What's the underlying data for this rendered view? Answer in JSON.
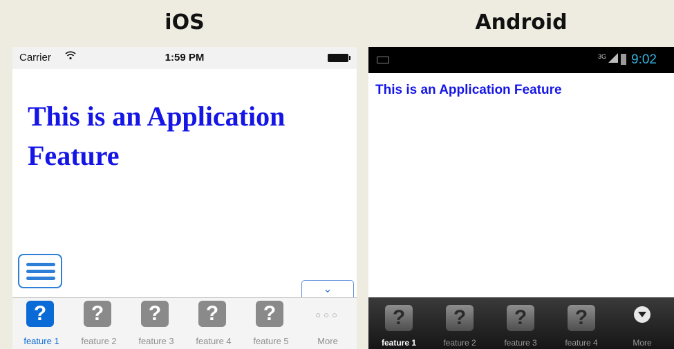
{
  "headings": {
    "ios": "iOS",
    "android": "Android"
  },
  "ios": {
    "status": {
      "carrier": "Carrier",
      "wifi_icon": "wifi-icon",
      "time": "1:59 PM"
    },
    "content_title": "This is an Application Feature",
    "tab_icon_glyph": "?",
    "collapse_glyph": "⌄",
    "tabs": [
      {
        "label": "feature 1",
        "active": true
      },
      {
        "label": "feature 2"
      },
      {
        "label": "feature 3"
      },
      {
        "label": "feature 4"
      },
      {
        "label": "feature 5"
      },
      {
        "label": "More",
        "icon": "more-dots-icon",
        "glyph": "○○○"
      }
    ],
    "colors": {
      "accent": "#0a6ad6",
      "title": "#1515e6"
    }
  },
  "android": {
    "status": {
      "network": "3G",
      "time": "9:02"
    },
    "content_title": "This is an Application Feature",
    "tab_icon_glyph": "?",
    "tabs": [
      {
        "label": "feature 1",
        "active": true
      },
      {
        "label": "feature 2"
      },
      {
        "label": "feature 3"
      },
      {
        "label": "feature 4"
      },
      {
        "label": "More",
        "icon": "more-circle-icon"
      }
    ],
    "colors": {
      "clock": "#33b5e5",
      "title": "#1515e6"
    }
  }
}
